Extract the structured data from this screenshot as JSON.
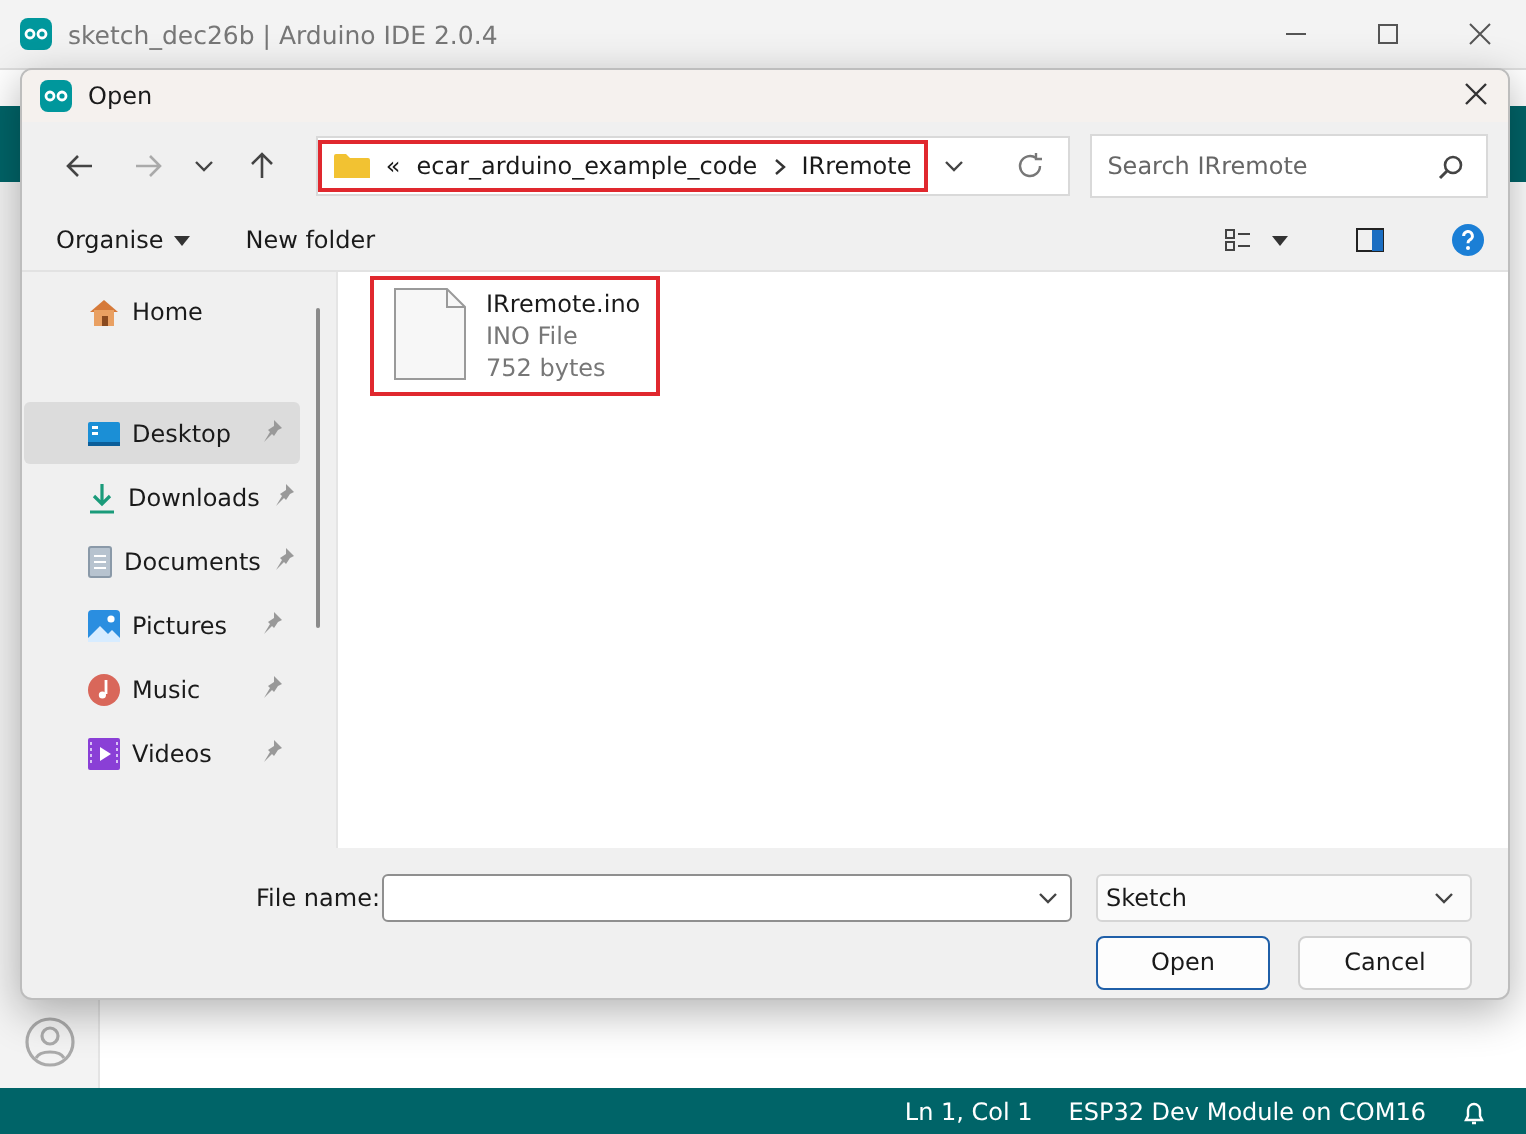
{
  "ide": {
    "title": "sketch_dec26b | Arduino IDE 2.0.4",
    "status_bar": {
      "position": "Ln 1, Col 1",
      "board": "ESP32 Dev Module on COM16"
    }
  },
  "dialog": {
    "title": "Open",
    "address": {
      "overflow": "«",
      "path": [
        "ecar_arduino_example_code",
        "IRremote"
      ],
      "highlighted": true
    },
    "search": {
      "placeholder": "Search IRremote"
    },
    "toolbar": {
      "organise": "Organise",
      "new_folder": "New folder"
    },
    "nav_items": [
      {
        "label": "Home",
        "kind": "home",
        "pinned": false,
        "selected": false
      },
      {
        "label": "Desktop",
        "kind": "desktop",
        "pinned": true,
        "selected": true
      },
      {
        "label": "Downloads",
        "kind": "downloads",
        "pinned": true,
        "selected": false
      },
      {
        "label": "Documents",
        "kind": "documents",
        "pinned": true,
        "selected": false
      },
      {
        "label": "Pictures",
        "kind": "pictures",
        "pinned": true,
        "selected": false
      },
      {
        "label": "Music",
        "kind": "music",
        "pinned": true,
        "selected": false
      },
      {
        "label": "Videos",
        "kind": "videos",
        "pinned": true,
        "selected": false
      }
    ],
    "files": [
      {
        "name": "IRremote.ino",
        "type": "INO File",
        "size": "752 bytes",
        "highlighted": true
      }
    ],
    "file_name": {
      "label": "File name:"
    },
    "filter": {
      "value": "Sketch"
    },
    "buttons": [
      {
        "label": "Open",
        "default": true
      },
      {
        "label": "Cancel",
        "default": false
      }
    ]
  }
}
